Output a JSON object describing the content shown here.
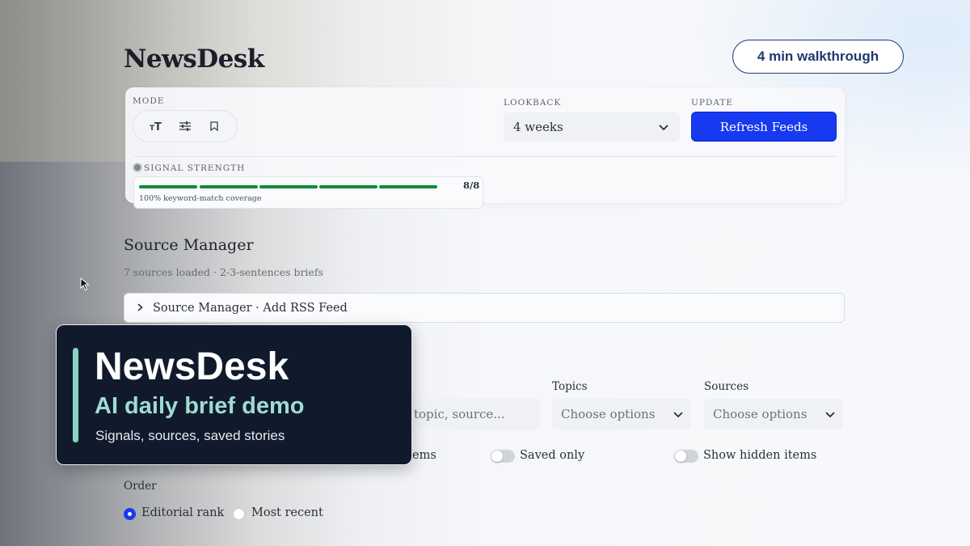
{
  "app": {
    "title": "NewsDesk",
    "walkthrough_label": "4 min walkthrough"
  },
  "controls": {
    "mode_label": "MODE",
    "mode_buttons": [
      {
        "icon": "text-size-icon",
        "glyph": "ᴛT"
      },
      {
        "icon": "sliders-icon",
        "glyph": "≡"
      },
      {
        "icon": "bookmark-icon",
        "glyph": ""
      }
    ],
    "lookback_label": "LOOKBACK",
    "lookback_value": "4 weeks",
    "update_label": "UPDATE",
    "refresh_label": "Refresh Feeds",
    "signal_label": "SIGNAL STRENGTH",
    "signal_count": "8/8",
    "signal_fraction": 1.0,
    "signal_caption": "100% keyword-match coverage"
  },
  "source_manager": {
    "title": "Source Manager",
    "subtitle": "7 sources loaded · 2-3-sentences briefs",
    "expander_label": "Source Manager · Add RSS Feed"
  },
  "filters": {
    "search_placeholder_partial": "topic, source...",
    "topics_label": "Topics",
    "topics_placeholder": "Choose options",
    "sources_label": "Sources",
    "sources_placeholder": "Choose options",
    "toggle_partial_label": "ems",
    "saved_only_label": "Saved only",
    "show_hidden_label": "Show hidden items",
    "order_label": "Order",
    "order_options": [
      {
        "label": "Editorial rank",
        "selected": true
      },
      {
        "label": "Most recent",
        "selected": false
      }
    ]
  },
  "overlay": {
    "title": "NewsDesk",
    "subtitle": "AI daily brief demo",
    "description": "Signals, sources, saved stories"
  },
  "colors": {
    "accent": "#1739f0",
    "signal_green": "#15883a",
    "overlay_bg": "#111a2c",
    "overlay_accent": "#86d3c2"
  }
}
